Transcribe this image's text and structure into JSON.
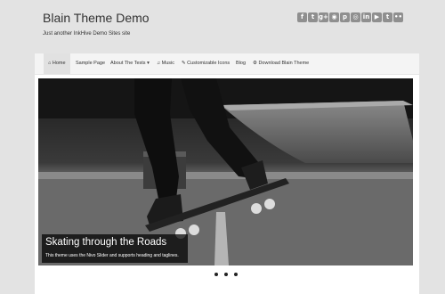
{
  "site": {
    "title": "Blain Theme Demo",
    "tagline": "Just another InkHive Demo Sites site"
  },
  "social_icons": [
    {
      "name": "facebook-icon",
      "glyph": "f"
    },
    {
      "name": "twitter-icon",
      "glyph": "t"
    },
    {
      "name": "google-plus-icon",
      "glyph": "g+"
    },
    {
      "name": "rss-icon",
      "glyph": "◉"
    },
    {
      "name": "pinterest-icon",
      "glyph": "p"
    },
    {
      "name": "instagram-icon",
      "glyph": "◎"
    },
    {
      "name": "linkedin-icon",
      "glyph": "in"
    },
    {
      "name": "youtube-icon",
      "glyph": "▶"
    },
    {
      "name": "tumblr-icon",
      "glyph": "t"
    },
    {
      "name": "flickr-icon",
      "glyph": "••"
    }
  ],
  "nav": {
    "home": "⌂ Home",
    "sample_page": "Sample Page",
    "about_tests": "About The Tests ▾",
    "music": "♫ Music",
    "customizable_icons": "✎ Customizable Icons",
    "blog": "Blog",
    "download": "⚙ Download Blain Theme"
  },
  "slider": {
    "title": "Skating through the Roads",
    "text": "This theme uses the Nivo Slider and supports heading and taglines.",
    "slide_count": 3,
    "active_slide": 1
  }
}
